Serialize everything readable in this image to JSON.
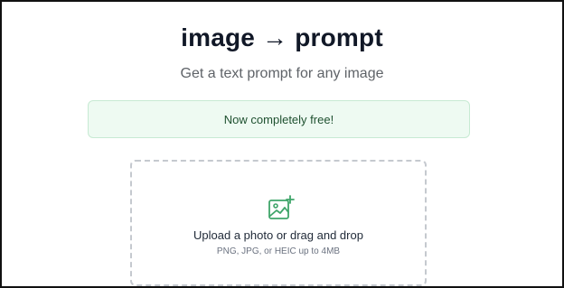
{
  "header": {
    "title": "image → prompt",
    "subtitle": "Get a text prompt for any image"
  },
  "banner": {
    "text": "Now completely free!"
  },
  "upload": {
    "label": "Upload a photo or drag and drop",
    "hint": "PNG, JPG, or HEIC up to 4MB",
    "icon": "image-add-icon"
  },
  "colors": {
    "accent": "#3fa56a",
    "banner_bg": "#eefaf2",
    "banner_border": "#c7ead3"
  }
}
